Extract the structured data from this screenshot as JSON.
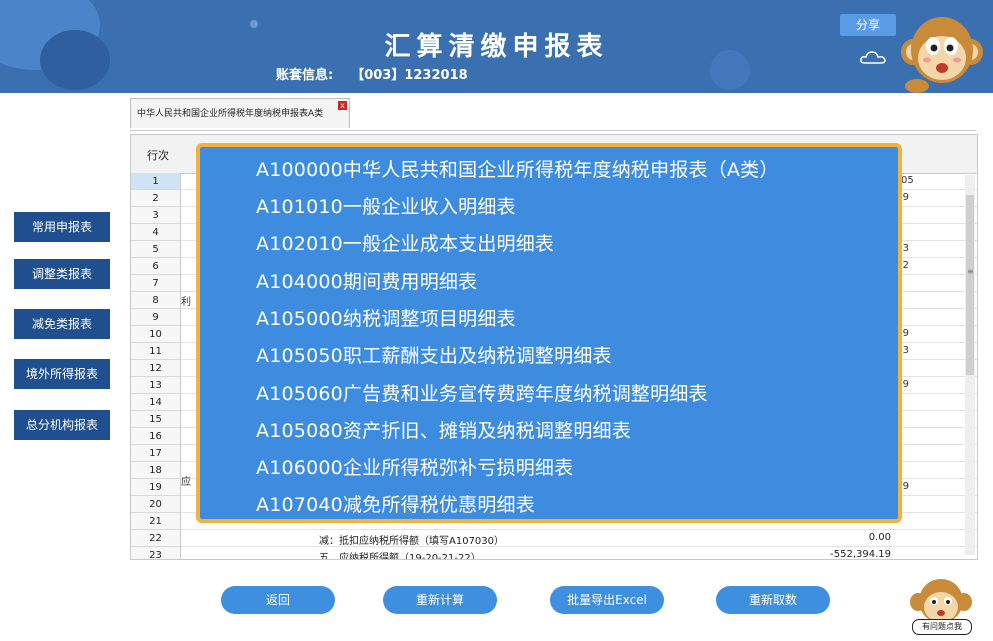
{
  "header": {
    "title": "汇算清缴申报表",
    "account_label": "账套信息:",
    "account_value": "【003】1232018",
    "share_label": "分享"
  },
  "sidebar": {
    "items": [
      {
        "label": "常用申报表"
      },
      {
        "label": "调整类报表"
      },
      {
        "label": "减免类报表"
      },
      {
        "label": "境外所得报表"
      },
      {
        "label": "总分机构报表"
      }
    ]
  },
  "tab": {
    "label": "中华人民共和国企业所得税年度纳税申报表A类",
    "close": "x"
  },
  "table": {
    "column_header": "行次",
    "rows": [
      "1",
      "2",
      "3",
      "4",
      "5",
      "6",
      "7",
      "8",
      "9",
      "10",
      "11",
      "12",
      "13",
      "14",
      "15",
      "16",
      "17",
      "18",
      "19",
      "20",
      "21",
      "22",
      "23"
    ],
    "group_labels": {
      "g1": "利",
      "g2": "应"
    },
    "edge_values": {
      "r1": "05",
      "r2": "9",
      "r5": "3",
      "r6": "2",
      "r10": "9",
      "r11": "3",
      "r13": "9",
      "r19": "9"
    },
    "row22": {
      "desc": "减：抵扣应纳税所得额（填写A107030）",
      "amount": "0.00"
    },
    "row23": {
      "desc": "五、应纳税所得额（19-20-21-22）",
      "amount": "-552,394.19"
    }
  },
  "popup": {
    "items": [
      "A100000中华人民共和国企业所得税年度纳税申报表（A类）",
      "A101010一般企业收入明细表",
      "A102010一般企业成本支出明细表",
      "A104000期间费用明细表",
      "A105000纳税调整项目明细表",
      "A105050职工薪酬支出及纳税调整明细表",
      "A105060广告费和业务宣传费跨年度纳税调整明细表",
      "A105080资产折旧、摊销及纳税调整明细表",
      "A106000企业所得税弥补亏损明细表",
      "A107040减免所得税优惠明细表"
    ]
  },
  "footer": {
    "buttons": [
      "返回",
      "重新计算",
      "批量导出Excel",
      "重新取数"
    ],
    "help_label": "有问题点我"
  },
  "colors": {
    "header_bg": "#3a6fb0",
    "sidebar_btn": "#1f4f8e",
    "popup_bg": "#3d8ce0",
    "popup_border": "#f2b33d",
    "bottom_btn": "#3f8fe0"
  }
}
